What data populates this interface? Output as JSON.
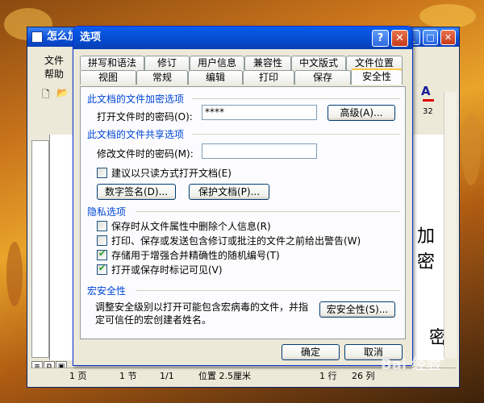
{
  "word_window": {
    "title": "怎么加",
    "menu_items": [
      "文件",
      "帮助"
    ],
    "ruler_number": "32",
    "doc_text_right_1": "加密",
    "doc_text_right_2": "密",
    "doc_text_left_1": "'",
    "doc_text_left_2": "'",
    "status": {
      "page": "1 页",
      "section": "1 节",
      "pages": "1/1",
      "position": "位置 2.5厘米",
      "line": "1 行",
      "col": "26 列"
    }
  },
  "dialog": {
    "title": "选项",
    "help_label": "?",
    "close_label": "✕",
    "tabs_row1": [
      "拼写和语法",
      "修订",
      "用户信息",
      "兼容性",
      "中文版式",
      "文件位置"
    ],
    "tabs_row2": [
      "视图",
      "常规",
      "编辑",
      "打印",
      "保存",
      "安全性"
    ],
    "active_tab": "安全性",
    "encrypt_section": {
      "title": "此文档的文件加密选项",
      "open_password_label": "打开文件时的密码(O):",
      "open_password_value": "****",
      "advanced_button": "高级(A)..."
    },
    "share_section": {
      "title": "此文档的文件共享选项",
      "modify_password_label": "修改文件时的密码(M):",
      "modify_password_value": "",
      "readonly_label": "建议以只读方式打开文档(E)",
      "readonly_checked": false,
      "digital_signature_button": "数字签名(D)...",
      "protect_document_button": "保护文档(P)..."
    },
    "privacy_section": {
      "title": "隐私选项",
      "options": [
        {
          "label": "保存时从文件属性中删除个人信息(R)",
          "checked": false
        },
        {
          "label": "打印、保存或发送包含修订或批注的文件之前给出警告(W)",
          "checked": false
        },
        {
          "label": "存储用于增强合并精确性的随机编号(T)",
          "checked": true
        },
        {
          "label": "打开或保存时标记可见(V)",
          "checked": true
        }
      ]
    },
    "macro_section": {
      "title": "宏安全性",
      "description_1": "调整安全级别以打开可能包含宏病毒的文件，并指",
      "description_2": "定可信任的宏创建者姓名。",
      "macro_button": "宏安全性(S)..."
    },
    "ok_button": "确定",
    "cancel_button": "取消"
  },
  "watermark": "Bai 经验"
}
